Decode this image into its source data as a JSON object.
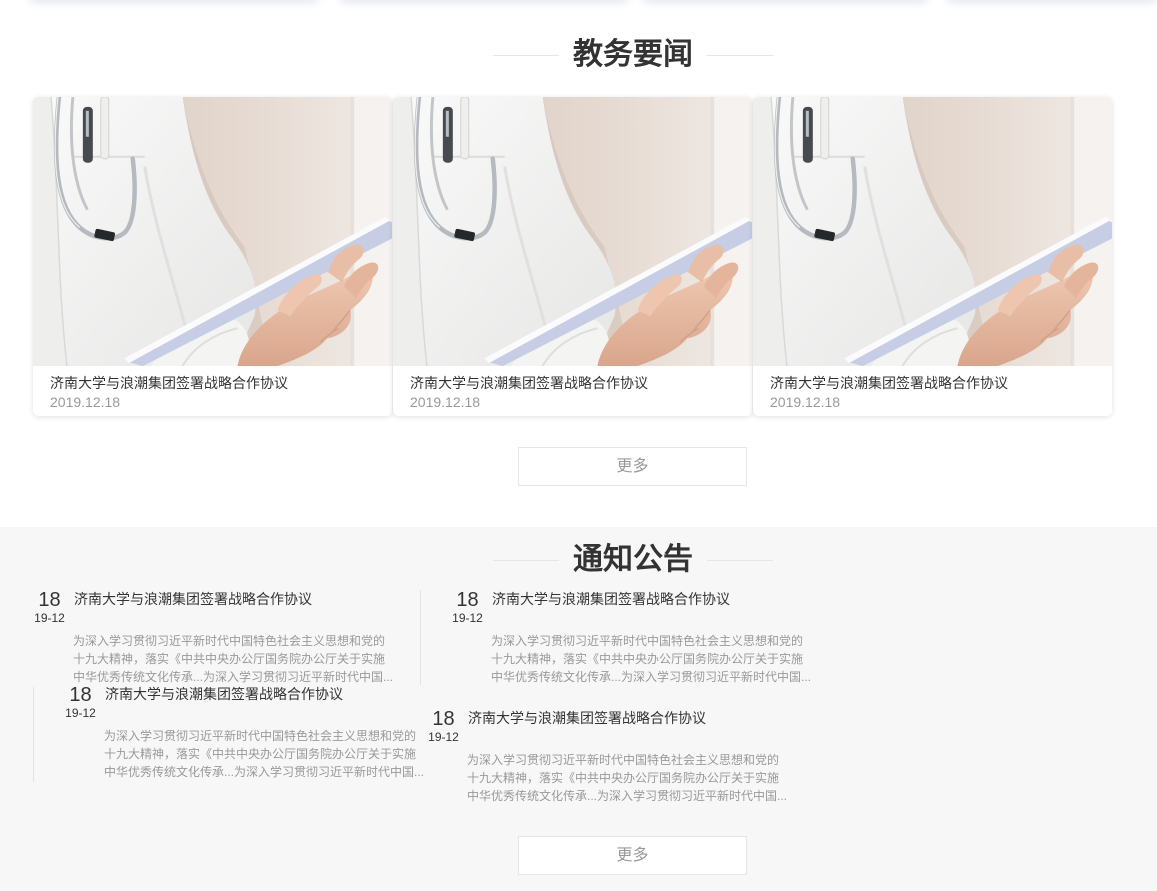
{
  "theme": {
    "title_color": "#333333",
    "muted_color": "#999999",
    "section_alt_bg": "#f7f7f7"
  },
  "news": {
    "title": "教务要闻",
    "items": [
      {
        "title": "济南大学与浪潮集团签署战略合作协议",
        "date": "2019.12.18"
      },
      {
        "title": "济南大学与浪潮集团签署战略合作协议",
        "date": "2019.12.18"
      },
      {
        "title": "济南大学与浪潮集团签署战略合作协议",
        "date": "2019.12.18"
      }
    ],
    "more_label": "更多"
  },
  "notices": {
    "title": "通知公告",
    "items": [
      {
        "day": "18",
        "month": "19-12",
        "title": "济南大学与浪潮集团签署战略合作协议",
        "desc_lines": [
          "为深入学习贯彻习近平新时代中国特色社会主义思想和党的",
          "十九大精神，落实《中共中央办公厅国务院办公厅关于实施",
          "中华优秀传统文化传承...为深入学习贯彻习近平新时代中国..."
        ]
      },
      {
        "day": "18",
        "month": "19-12",
        "title": "济南大学与浪潮集团签署战略合作协议",
        "desc_lines": [
          "为深入学习贯彻习近平新时代中国特色社会主义思想和党的",
          "十九大精神，落实《中共中央办公厅国务院办公厅关于实施",
          "中华优秀传统文化传承...为深入学习贯彻习近平新时代中国..."
        ]
      },
      {
        "day": "18",
        "month": "19-12",
        "title": "济南大学与浪潮集团签署战略合作协议",
        "desc_lines": [
          "为深入学习贯彻习近平新时代中国特色社会主义思想和党的",
          "十九大精神，落实《中共中央办公厅国务院办公厅关于实施",
          "中华优秀传统文化传承...为深入学习贯彻习近平新时代中国..."
        ]
      },
      {
        "day": "18",
        "month": "19-12",
        "title": "济南大学与浪潮集团签署战略合作协议",
        "desc_lines": [
          "为深入学习贯彻习近平新时代中国特色社会主义思想和党的",
          "十九大精神，落实《中共中央办公厅国务院办公厅关于实施",
          "中华优秀传统文化传承...为深入学习贯彻习近平新时代中国..."
        ]
      }
    ],
    "more_label": "更多"
  }
}
